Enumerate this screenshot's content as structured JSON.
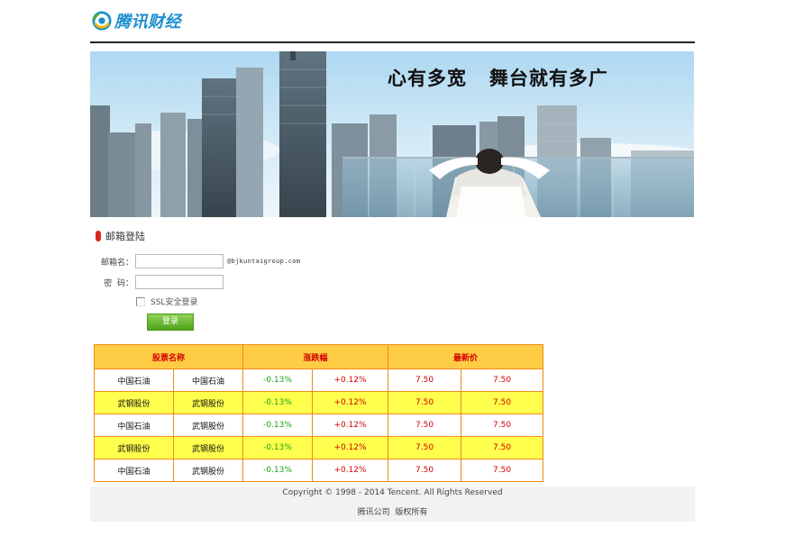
{
  "brand": {
    "name": "腾讯财经"
  },
  "banner": {
    "slogan": "心有多宽   舞台就有多广"
  },
  "login": {
    "title": "邮箱登陆",
    "email_label": "邮箱名：",
    "email_value": "",
    "email_suffix": "@bjkuntaigroup.com",
    "password_label": "密  码：",
    "password_value": "",
    "ssl_label": "SSL安全登录",
    "ssl_checked": false,
    "submit_label": "登录"
  },
  "stocks": {
    "headers": [
      "股票名称",
      "涨跌幅",
      "最新价"
    ],
    "rows": [
      {
        "name1": "中国石油",
        "name2": "中国石油",
        "chg1": "-0.13%",
        "chg2": "+0.12%",
        "price1": "7.50",
        "price2": "7.50"
      },
      {
        "name1": "武钢股份",
        "name2": "武钢股份",
        "chg1": "-0.13%",
        "chg2": "+0.12%",
        "price1": "7.50",
        "price2": "7.50"
      },
      {
        "name1": "中国石油",
        "name2": "武钢股份",
        "chg1": "-0.13%",
        "chg2": "+0.12%",
        "price1": "7.50",
        "price2": "7.50"
      },
      {
        "name1": "武钢股份",
        "name2": "武钢股份",
        "chg1": "-0.13%",
        "chg2": "+0.12%",
        "price1": "7.50",
        "price2": "7.50"
      },
      {
        "name1": "中国石油",
        "name2": "武钢股份",
        "chg1": "-0.13%",
        "chg2": "+0.12%",
        "price1": "7.50",
        "price2": "7.50"
      }
    ]
  },
  "footer": {
    "copyright": "Copyright © 1998 - 2014 Tencent. All Rights Reserved",
    "company": "腾讯公司  版权所有"
  },
  "colors": {
    "brand_blue": "#1a8fd0",
    "table_header_bg": "#fecc44",
    "table_border": "#ef8c17",
    "row_highlight": "#ffff4d",
    "up_red": "#d40000",
    "down_green": "#1aa51a",
    "button_green": "#5cb124"
  },
  "icons": [
    "tencent-logo-icon",
    "mail-icon",
    "checkbox"
  ]
}
